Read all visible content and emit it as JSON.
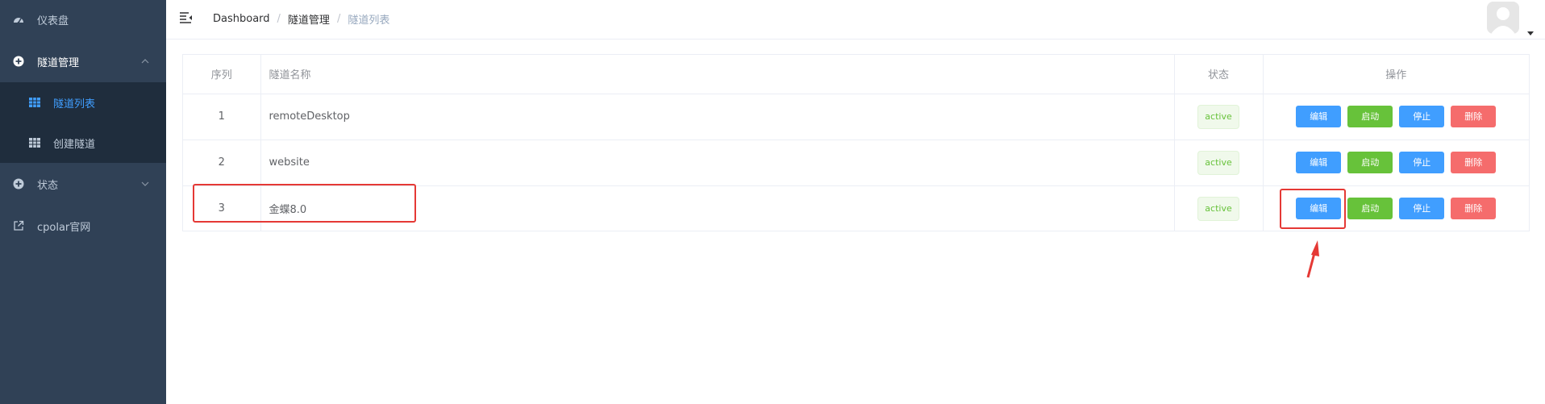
{
  "sidebar": {
    "items": [
      {
        "label": "仪表盘",
        "icon": "dashboard-icon"
      },
      {
        "label": "隧道管理",
        "icon": "plus-circle-icon",
        "open": true
      },
      {
        "label": "状态",
        "icon": "plus-circle-icon"
      },
      {
        "label": "cpolar官网",
        "icon": "external-link-icon"
      }
    ],
    "submenu": [
      {
        "label": "隧道列表",
        "icon": "table-grid-icon",
        "active": true
      },
      {
        "label": "创建隧道",
        "icon": "table-grid-icon"
      }
    ]
  },
  "breadcrumb": [
    "Dashboard",
    "隧道管理",
    "隧道列表"
  ],
  "table": {
    "headers": [
      "序列",
      "隧道名称",
      "状态",
      "操作"
    ],
    "rows": [
      {
        "index": "1",
        "name": "remoteDesktop",
        "status": "active"
      },
      {
        "index": "2",
        "name": "website",
        "status": "active"
      },
      {
        "index": "3",
        "name": "金蝶8.0",
        "status": "active"
      }
    ],
    "actions": [
      "编辑",
      "启动",
      "停止",
      "删除"
    ]
  },
  "colors": {
    "sidebar_bg": "#304156",
    "submenu_bg": "#1f2d3d",
    "active": "#409eff",
    "success": "#67c23a",
    "danger": "#f56c6c",
    "annotation": "#e53935"
  }
}
